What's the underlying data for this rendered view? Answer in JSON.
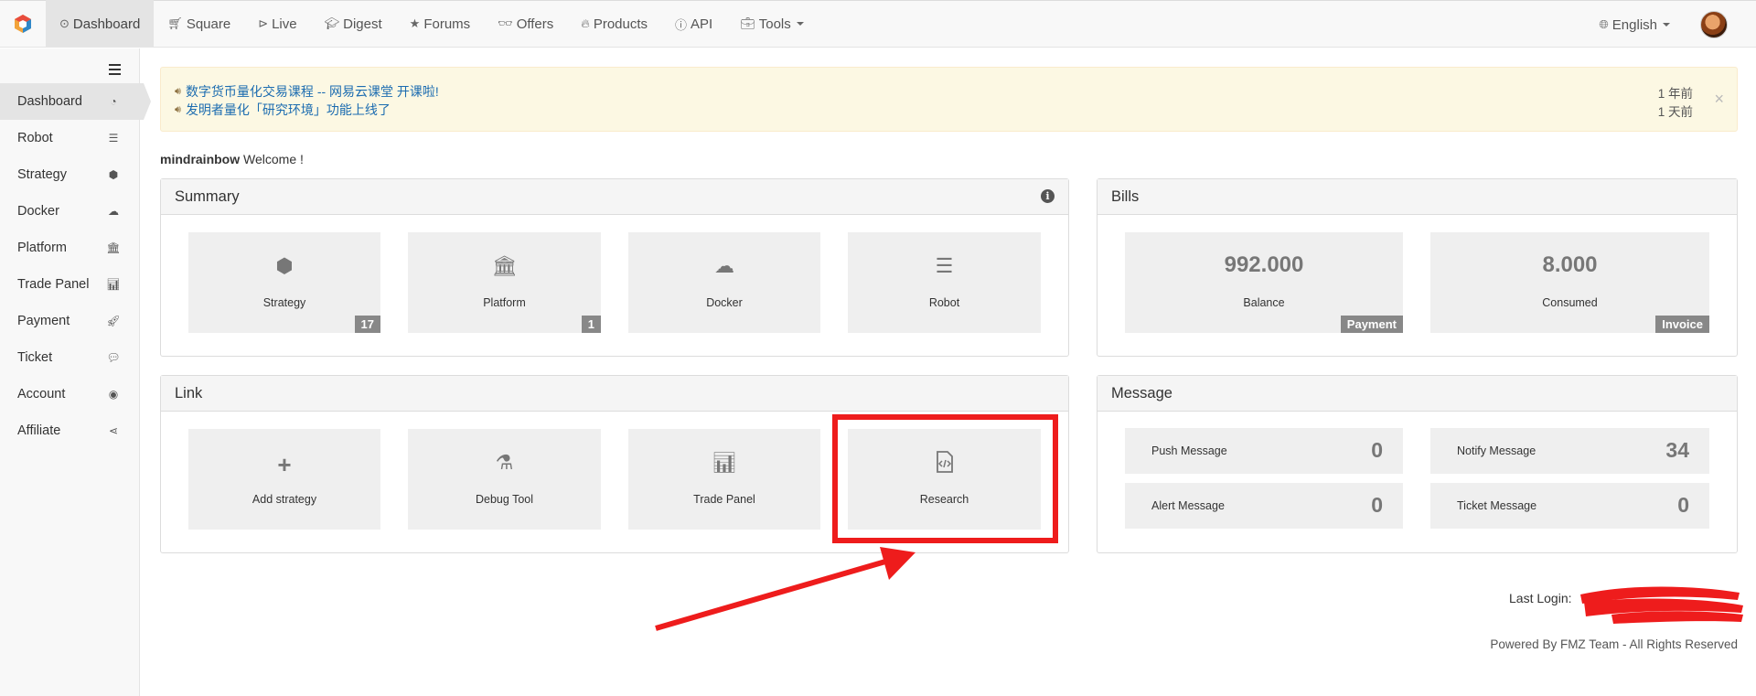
{
  "nav": {
    "items": [
      {
        "icon": "clock-icon",
        "label": "Dashboard"
      },
      {
        "icon": "cart-icon",
        "label": "Square"
      },
      {
        "icon": "play-icon",
        "label": "Live"
      },
      {
        "icon": "graduation-cap-icon",
        "label": "Digest"
      },
      {
        "icon": "star-icon",
        "label": "Forums"
      },
      {
        "icon": "glasses-icon",
        "label": "Offers"
      },
      {
        "icon": "fire-icon",
        "label": "Products"
      },
      {
        "icon": "info-circle-icon",
        "label": "API"
      },
      {
        "icon": "briefcase-icon",
        "label": "Tools"
      }
    ],
    "language": "English"
  },
  "sidebar": {
    "items": [
      {
        "label": "Dashboard",
        "icon": "dashboard-icon"
      },
      {
        "label": "Robot",
        "icon": "tasks-icon"
      },
      {
        "label": "Strategy",
        "icon": "cube-icon"
      },
      {
        "label": "Docker",
        "icon": "cloud-icon"
      },
      {
        "label": "Platform",
        "icon": "bank-icon"
      },
      {
        "label": "Trade Panel",
        "icon": "bar-chart-icon"
      },
      {
        "label": "Payment",
        "icon": "rocket-icon"
      },
      {
        "label": "Ticket",
        "icon": "comment-icon"
      },
      {
        "label": "Account",
        "icon": "user-circle-icon"
      },
      {
        "label": "Affiliate",
        "icon": "share-icon"
      }
    ]
  },
  "notices": [
    {
      "text": "数字货币量化交易课程 -- 网易云课堂 开课啦!",
      "time": "1 年前"
    },
    {
      "text": "发明者量化「研究环境」功能上线了",
      "time": "1 天前"
    }
  ],
  "welcome": {
    "user": "mindrainbow",
    "text": "Welcome !"
  },
  "summary": {
    "title": "Summary",
    "tiles": [
      {
        "label": "Strategy",
        "icon": "cube-icon",
        "badge": "17"
      },
      {
        "label": "Platform",
        "icon": "bank-icon",
        "badge": "1"
      },
      {
        "label": "Docker",
        "icon": "cloud-icon",
        "badge": ""
      },
      {
        "label": "Robot",
        "icon": "tasks-icon",
        "badge": ""
      }
    ]
  },
  "bills": {
    "title": "Bills",
    "balance": {
      "value": "992.000",
      "label": "Balance",
      "badge": "Payment"
    },
    "consumed": {
      "value": "8.000",
      "label": "Consumed",
      "badge": "Invoice"
    }
  },
  "link": {
    "title": "Link",
    "tiles": [
      {
        "label": "Add strategy",
        "icon": "plus-icon"
      },
      {
        "label": "Debug Tool",
        "icon": "flask-icon"
      },
      {
        "label": "Trade Panel",
        "icon": "bar-chart-icon"
      },
      {
        "label": "Research",
        "icon": "code-file-icon"
      }
    ]
  },
  "message": {
    "title": "Message",
    "items": [
      {
        "label": "Push Message",
        "value": "0"
      },
      {
        "label": "Notify Message",
        "value": "34"
      },
      {
        "label": "Alert Message",
        "value": "0"
      },
      {
        "label": "Ticket Message",
        "value": "0"
      }
    ]
  },
  "footer": {
    "last_login": "Last Login: ",
    "powered": "Powered By FMZ Team - All Rights Reserved"
  },
  "colors": {
    "annotation_red": "#ee1c1c",
    "link_blue": "#1c6cb0",
    "alert_bg": "#fcf8e3"
  }
}
